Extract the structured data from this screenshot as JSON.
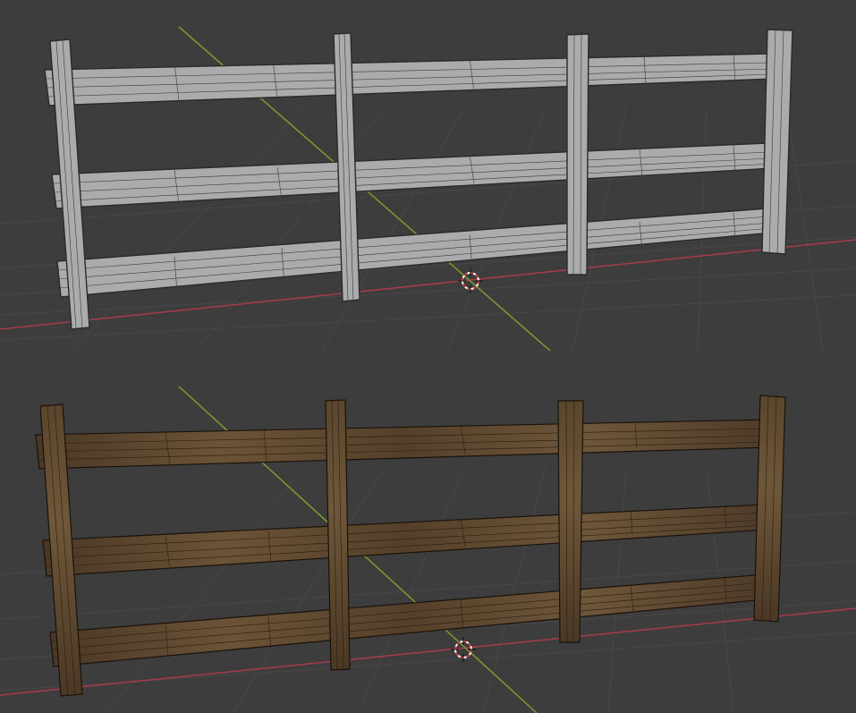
{
  "viewport": {
    "background": "#3d3d3d",
    "grid_color": "#4a4a4a",
    "x_axis_color": "#b23a4e",
    "y_axis_color": "#8ca832"
  },
  "panels": [
    {
      "name": "solid-mode",
      "shading": "solid",
      "fill": "#a9abac",
      "edge": "#2a2a2a"
    },
    {
      "name": "material-preview",
      "shading": "material",
      "fill": "#5c4630",
      "edge": "#1a120a"
    }
  ],
  "icons": {
    "cursor": "3d-cursor-icon"
  }
}
